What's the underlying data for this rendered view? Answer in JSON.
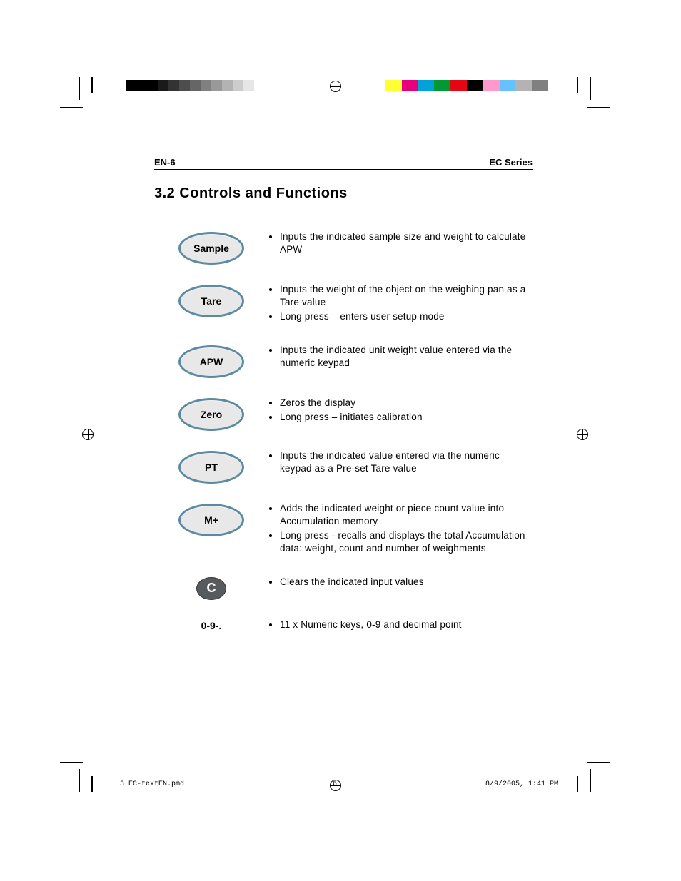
{
  "header": {
    "left": "EN-6",
    "right": "EC Series"
  },
  "section_title": "3.2 Controls and Functions",
  "controls": [
    {
      "label": "Sample",
      "kind": "oval",
      "bullets": [
        "Inputs the indicated sample size and weight to calculate APW"
      ]
    },
    {
      "label": "Tare",
      "kind": "oval",
      "bullets": [
        "Inputs the weight of the object on the weighing pan as a Tare value",
        "Long press – enters user setup mode"
      ]
    },
    {
      "label": "APW",
      "kind": "oval",
      "bullets": [
        "Inputs the indicated unit weight value entered via the numeric keypad"
      ]
    },
    {
      "label": "Zero",
      "kind": "oval",
      "bullets": [
        "Zeros the display",
        "Long press – initiates calibration"
      ]
    },
    {
      "label": "PT",
      "kind": "oval",
      "bullets": [
        "Inputs the indicated value entered via the numeric keypad as a Pre-set Tare value"
      ]
    },
    {
      "label": "M+",
      "kind": "oval",
      "bullets": [
        "Adds the indicated weight or piece count value into Accumulation memory",
        "Long press - recalls and displays the total Accumulation data: weight, count and number of weighments"
      ]
    },
    {
      "label": "C",
      "kind": "cbtn",
      "bullets": [
        "Clears the indicated input values"
      ]
    },
    {
      "label": "0-9-.",
      "kind": "text",
      "bullets": [
        "11 x Numeric keys, 0-9 and decimal point"
      ]
    }
  ],
  "footer": {
    "file": "3 EC-textEN.pmd",
    "page": "6",
    "datetime": "8/9/2005, 1:41 PM"
  },
  "colorbar_left": [
    "#000000",
    "#000000",
    "#000000",
    "#1a1a1a",
    "#333333",
    "#4d4d4d",
    "#666666",
    "#808080",
    "#999999",
    "#b3b3b3",
    "#cccccc",
    "#e6e6e6",
    "#ffffff",
    "#ffffff",
    "#ffffff"
  ],
  "colorbar_right": [
    "#ffff33",
    "#e6007e",
    "#00a3d9",
    "#009933",
    "#e30613",
    "#000000",
    "#ff99cc",
    "#66c2ff",
    "#b3b3b3",
    "#808080"
  ]
}
